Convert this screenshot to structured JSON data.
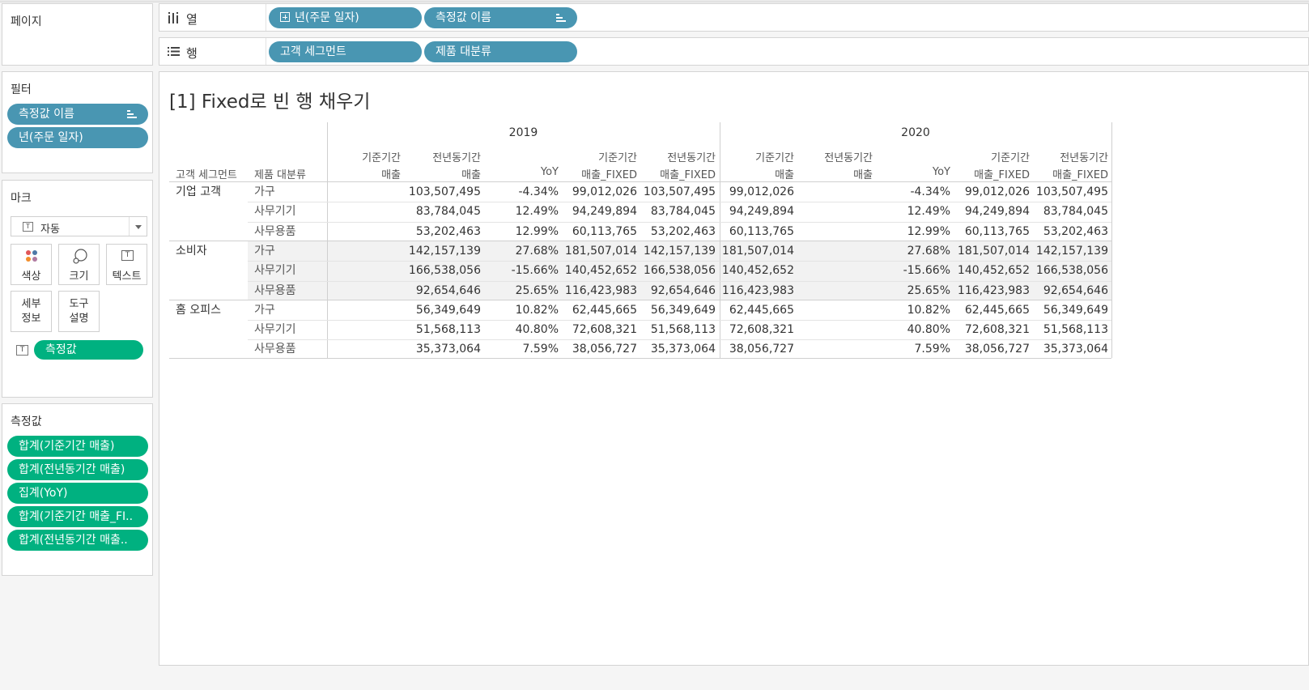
{
  "pages_card": {
    "title": "페이지"
  },
  "columns_shelf": {
    "label": "열",
    "pills": [
      "년(주문 일자)",
      "측정값 이름"
    ]
  },
  "rows_shelf": {
    "label": "행",
    "pills": [
      "고객 세그먼트",
      "제품 대분류"
    ]
  },
  "filters_card": {
    "title": "필터",
    "pills": [
      "측정값 이름",
      "년(주문 일자)"
    ]
  },
  "marks_card": {
    "title": "마크",
    "mark_type": "자동",
    "buttons": [
      {
        "label": "색상",
        "icon": "color-dots-icon"
      },
      {
        "label": "크기",
        "icon": "size-shapes-icon"
      },
      {
        "label": "텍스트",
        "icon": "text-icon"
      },
      {
        "label1": "세부",
        "label2": "정보"
      },
      {
        "label1": "도구",
        "label2": "설명"
      }
    ],
    "text_pill": "측정값"
  },
  "measures_card": {
    "title": "측정값",
    "pills": [
      "합계(기준기간 매출)",
      "합계(전년동기간 매출)",
      "집계(YoY)",
      "합계(기준기간 매출_FI..",
      "합계(전년동기간 매출.."
    ]
  },
  "view": {
    "title": "[1] Fixed로 빈 행 채우기",
    "row_headers": [
      "고객 세그먼트",
      "제품 대분류"
    ],
    "years": [
      "2019",
      "2020"
    ],
    "measure_headers": [
      {
        "l1": "기준기간",
        "l2": "매출"
      },
      {
        "l1": "전년동기간",
        "l2": "매출"
      },
      {
        "l1": "",
        "l2": "YoY"
      },
      {
        "l1": "기준기간",
        "l2": "매출_FIXED"
      },
      {
        "l1": "전년동기간",
        "l2": "매출_FIXED"
      }
    ],
    "segments": [
      {
        "name": "기업 고객",
        "rows": [
          {
            "cat": "가구",
            "vals": [
              "",
              "103,507,495",
              "-4.34%",
              "99,012,026",
              "103,507,495",
              "99,012,026",
              "",
              "-4.34%",
              "99,012,026",
              "103,507,495"
            ]
          },
          {
            "cat": "사무기기",
            "vals": [
              "",
              "83,784,045",
              "12.49%",
              "94,249,894",
              "83,784,045",
              "94,249,894",
              "",
              "12.49%",
              "94,249,894",
              "83,784,045"
            ]
          },
          {
            "cat": "사무용품",
            "vals": [
              "",
              "53,202,463",
              "12.99%",
              "60,113,765",
              "53,202,463",
              "60,113,765",
              "",
              "12.99%",
              "60,113,765",
              "53,202,463"
            ]
          }
        ]
      },
      {
        "name": "소비자",
        "rows": [
          {
            "cat": "가구",
            "vals": [
              "",
              "142,157,139",
              "27.68%",
              "181,507,014",
              "142,157,139",
              "181,507,014",
              "",
              "27.68%",
              "181,507,014",
              "142,157,139"
            ]
          },
          {
            "cat": "사무기기",
            "vals": [
              "",
              "166,538,056",
              "-15.66%",
              "140,452,652",
              "166,538,056",
              "140,452,652",
              "",
              "-15.66%",
              "140,452,652",
              "166,538,056"
            ]
          },
          {
            "cat": "사무용품",
            "vals": [
              "",
              "92,654,646",
              "25.65%",
              "116,423,983",
              "92,654,646",
              "116,423,983",
              "",
              "25.65%",
              "116,423,983",
              "92,654,646"
            ]
          }
        ]
      },
      {
        "name": "홈 오피스",
        "rows": [
          {
            "cat": "가구",
            "vals": [
              "",
              "56,349,649",
              "10.82%",
              "62,445,665",
              "56,349,649",
              "62,445,665",
              "",
              "10.82%",
              "62,445,665",
              "56,349,649"
            ]
          },
          {
            "cat": "사무기기",
            "vals": [
              "",
              "51,568,113",
              "40.80%",
              "72,608,321",
              "51,568,113",
              "72,608,321",
              "",
              "40.80%",
              "72,608,321",
              "51,568,113"
            ]
          },
          {
            "cat": "사무용품",
            "vals": [
              "",
              "35,373,064",
              "7.59%",
              "38,056,727",
              "35,373,064",
              "38,056,727",
              "",
              "7.59%",
              "38,056,727",
              "35,373,064"
            ]
          }
        ]
      }
    ]
  }
}
